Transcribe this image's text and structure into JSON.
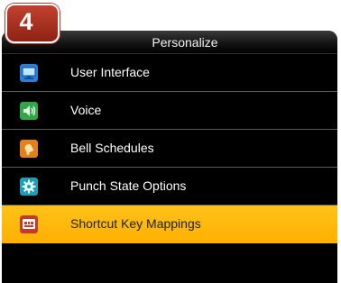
{
  "step_badge": "4",
  "header": {
    "title": "Personalize"
  },
  "menu": {
    "items": [
      {
        "label": "User Interface",
        "icon": "monitor-icon"
      },
      {
        "label": "Voice",
        "icon": "speaker-icon"
      },
      {
        "label": "Bell Schedules",
        "icon": "bell-icon"
      },
      {
        "label": "Punch State Options",
        "icon": "gear-icon"
      },
      {
        "label": "Shortcut Key Mappings",
        "icon": "keyboard-icon",
        "selected": true
      }
    ]
  },
  "colors": {
    "selection": "#ffb000",
    "background": "#000000",
    "badge": "#a93322"
  }
}
